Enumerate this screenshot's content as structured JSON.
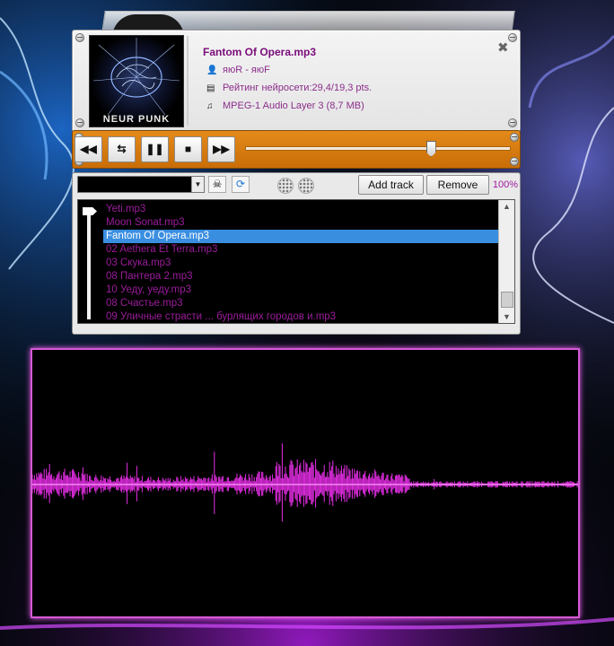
{
  "player": {
    "track_title": "Fantom Of Opera.mp3",
    "artist": "яюR - яюF",
    "rating": "Рейтинг нейросети:29,4/19,3 pts.",
    "format": "MPEG-1 Audio Layer 3 (8,7 MB)",
    "cover_text": "NEUR PUNK",
    "close_symbol": "✖"
  },
  "transport": {
    "prev_symbol": "◀◀",
    "repeat_symbol": "⇆",
    "pause_symbol": "❚❚",
    "stop_symbol": "■",
    "next_symbol": "▶▶",
    "seek_fraction": 0.7
  },
  "playlist": {
    "combo_value": "",
    "add_label": "Add track",
    "remove_label": "Remove",
    "volume": "100%",
    "selected_index": 2,
    "items": [
      "Yeti.mp3",
      "Moon Sonat.mp3",
      "Fantom Of Opera.mp3",
      "02 Aethera Et Terra.mp3",
      "03 Скука.mp3",
      "08 Пантера 2.mp3",
      "10 Уеду, уеду.mp3",
      "08 Счастье.mp3",
      "09 Уличные страсти ... бурлящих городов и.mp3"
    ]
  },
  "colors": {
    "accent_purple": "#9b1c9b",
    "transport_orange": "#d97a0f",
    "selection_blue": "#3a8ee0",
    "waveform_magenta": "#ff33ff"
  }
}
